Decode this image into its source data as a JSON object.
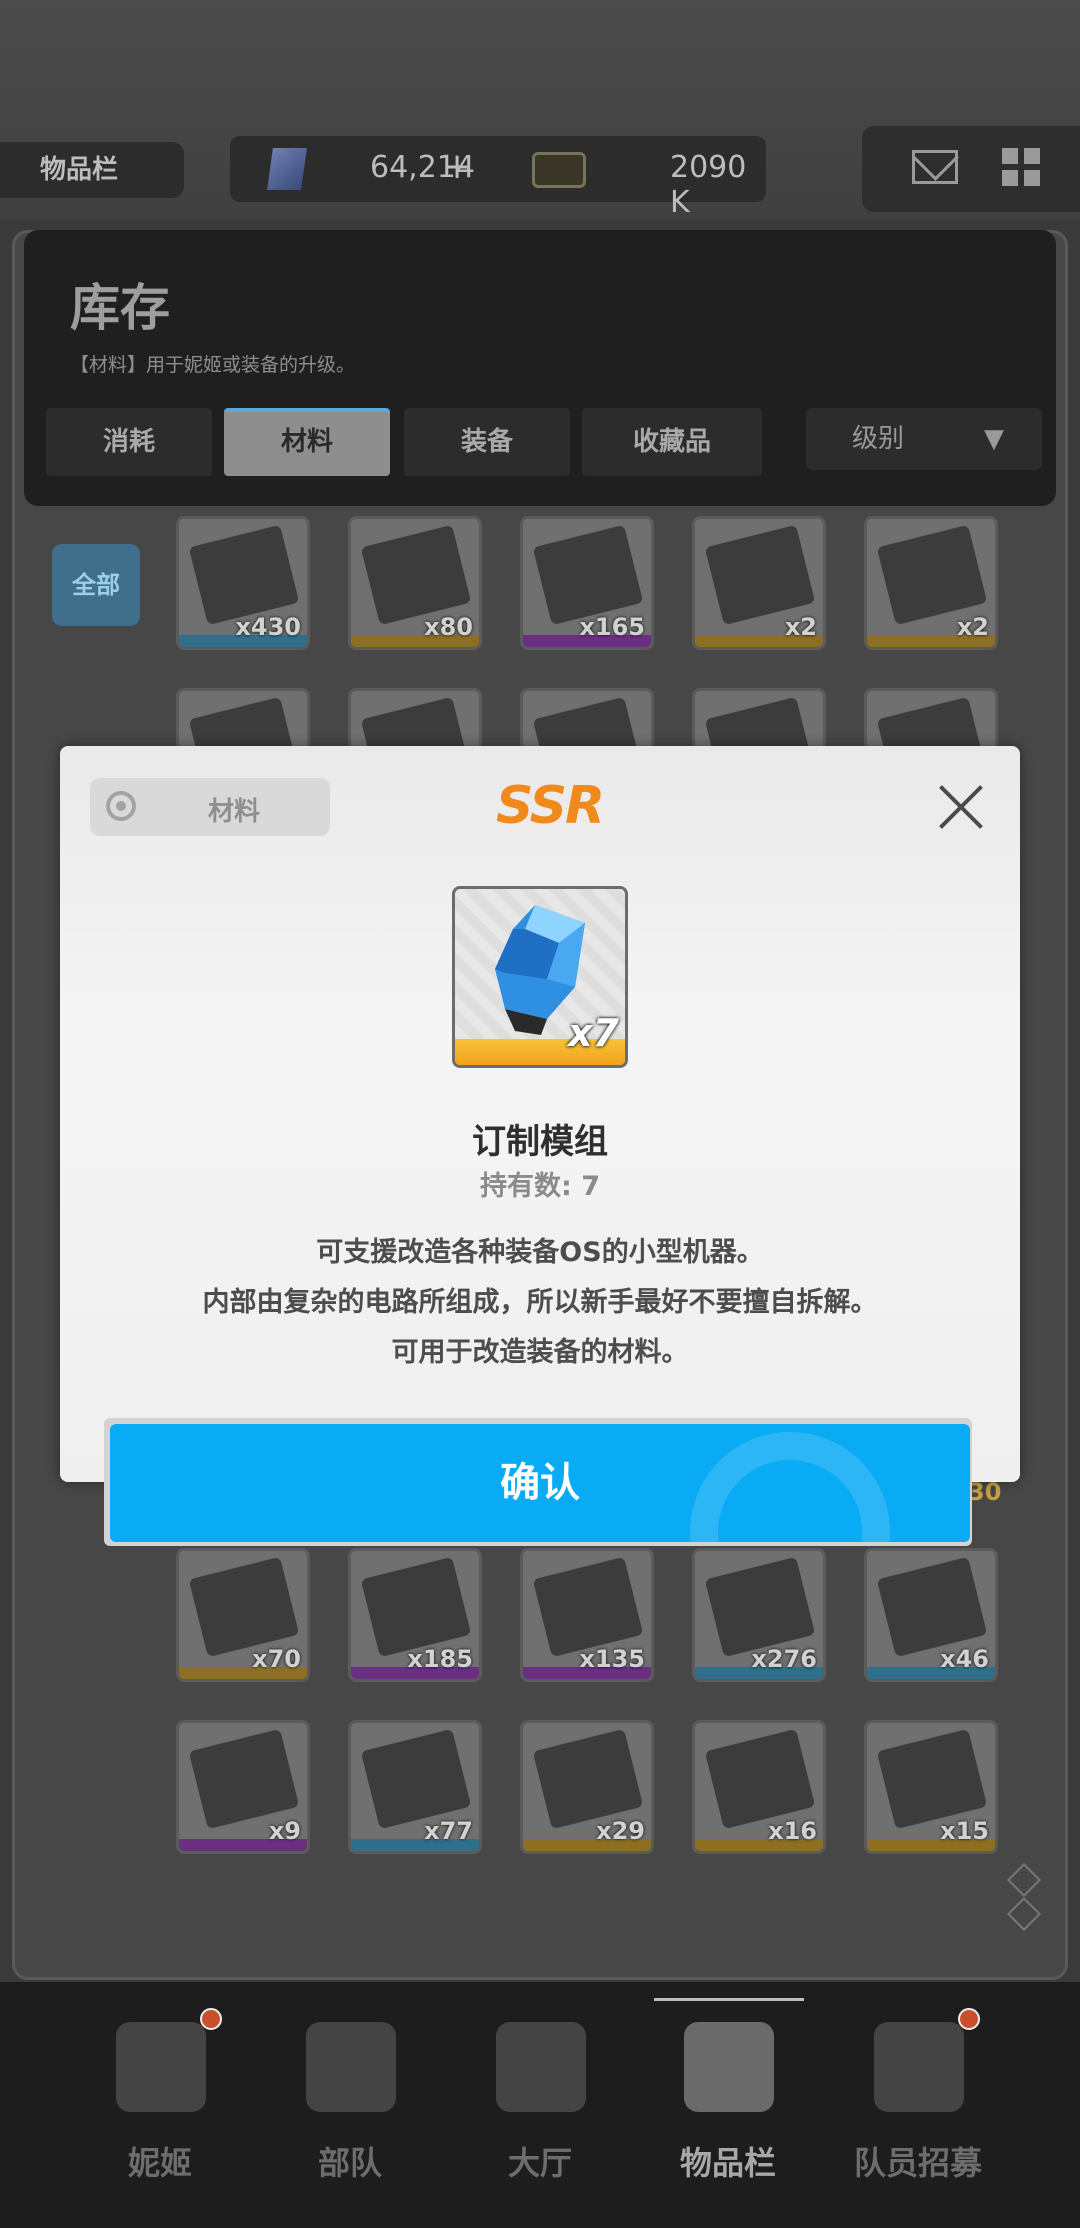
{
  "header": {
    "inventory_label": "物品栏",
    "gems": "64,214",
    "plus_icon": "+",
    "credits": "2090 K",
    "mail_icon": "mail-icon",
    "menu_icon": "grid-icon"
  },
  "storage": {
    "title": "库存",
    "description": "【材料】用于妮姬或装备的升级。",
    "tabs": [
      {
        "label": "消耗",
        "icon": "consumable-icon"
      },
      {
        "label": "材料",
        "icon": "material-icon",
        "active": true
      },
      {
        "label": "装备",
        "icon": "equipment-icon"
      },
      {
        "label": "收藏品",
        "icon": "collectible-icon"
      }
    ],
    "sort": {
      "label": "级别",
      "chevron": "▼"
    },
    "filter_all": "全部",
    "grid_rows": [
      [
        {
          "qty": "x430",
          "rarity": "r"
        },
        {
          "qty": "x80",
          "rarity": "ssr"
        },
        {
          "qty": "x165",
          "rarity": "sr"
        },
        {
          "qty": "x2",
          "rarity": "ssr"
        },
        {
          "qty": "x2",
          "rarity": "ssr"
        }
      ],
      [
        {
          "qty": "x70",
          "rarity": "ssr"
        },
        {
          "qty": "x185",
          "rarity": "sr"
        },
        {
          "qty": "x135",
          "rarity": "sr"
        },
        {
          "qty": "x276",
          "rarity": "r"
        },
        {
          "qty": "x46",
          "rarity": "r"
        }
      ],
      [
        {
          "qty": "x9",
          "rarity": "sr"
        },
        {
          "qty": "x77",
          "rarity": "r"
        },
        {
          "qty": "x29",
          "rarity": "ssr"
        },
        {
          "qty": "x16",
          "rarity": "ssr"
        },
        {
          "qty": "x15",
          "rarity": "ssr"
        }
      ]
    ],
    "partial_qty": "30"
  },
  "nav": [
    {
      "label": "妮姬",
      "icon": "nikke-icon",
      "dot": true
    },
    {
      "label": "部队",
      "icon": "squad-icon",
      "dot": false
    },
    {
      "label": "大厅",
      "icon": "lobby-icon",
      "dot": false
    },
    {
      "label": "物品栏",
      "icon": "inventory-icon",
      "dot": false,
      "active": true
    },
    {
      "label": "队员招募",
      "icon": "recruit-icon",
      "dot": true
    }
  ],
  "modal": {
    "category": "材料",
    "rarity": "SSR",
    "item_qty": "x7",
    "item_name": "订制模组",
    "own_count": "持有数: 7",
    "description": [
      "可支援改造各种装备OS的小型机器。",
      "内部由复杂的电路所组成，所以新手最好不要擅自拆解。",
      "可用于改造装备的材料。"
    ],
    "confirm": "确认",
    "colors": {
      "rarity": "#f08a1c",
      "confirm": "#0aabf5",
      "item_bar": "#f0a21a"
    }
  }
}
